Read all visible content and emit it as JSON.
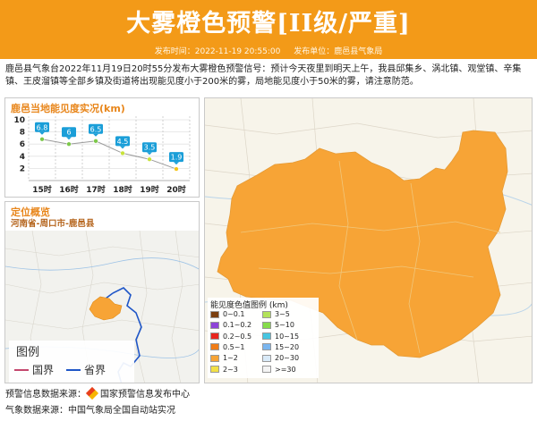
{
  "banner": {
    "title": "大雾橙色预警[II级/严重]",
    "publish_time_label": "发布时间：2022-11-19 20:55:00",
    "publisher_label": "发布单位：鹿邑县气象局",
    "color": "#f39a18"
  },
  "notice": {
    "text": "鹿邑县气象台2022年11月19日20时55分发布大雾橙色预警信号：预计今天夜里到明天上午，我县邱集乡、涡北镇、观堂镇、辛集镇、王皮溜镇等全部乡镇及街道将出现能见度小于200米的雾，局地能见度小于50米的雾，请注意防范。"
  },
  "visibility_panel": {
    "title": "鹿邑当地能见度实况(km)"
  },
  "chart_data": {
    "type": "line",
    "title": "鹿邑当地能见度实况(km)",
    "categories": [
      "15时",
      "16时",
      "17时",
      "18时",
      "19时",
      "20时"
    ],
    "values": [
      6.8,
      6,
      6.5,
      4.5,
      3.5,
      1.9
    ],
    "labels": [
      "6.8",
      "6",
      "6.5",
      "4.5",
      "3.5",
      "1.9"
    ],
    "yticks": [
      "10",
      "8",
      "6",
      "4",
      "2"
    ],
    "ylim": [
      0,
      10
    ],
    "grid": true,
    "line_color": "#9a9a9a",
    "marker_colors": [
      "#7dc84a",
      "#7dc84a",
      "#7dc84a",
      "#c8e23a",
      "#c8e23a",
      "#f5c51a"
    ],
    "label_box_color": "#1a9ed8"
  },
  "location_panel": {
    "title": "定位概览",
    "subtitle": "河南省-周口市-鹿邑县",
    "legend_title": "图例",
    "legend_items": [
      {
        "label": "国界",
        "color": "#c4476e"
      },
      {
        "label": "省界",
        "color": "#1f56c7"
      }
    ]
  },
  "map_legend": {
    "title": "能见度色值图例 (km)",
    "items": [
      {
        "label": "0~0.1",
        "color": "#7b3f10"
      },
      {
        "label": "3~5",
        "color": "#b3e35a"
      },
      {
        "label": "0.1~0.2",
        "color": "#8e44d8"
      },
      {
        "label": "5~10",
        "color": "#86dc4b"
      },
      {
        "label": "0.2~0.5",
        "color": "#e8261e"
      },
      {
        "label": "10~15",
        "color": "#47c5e0"
      },
      {
        "label": "0.5~1",
        "color": "#f07c17"
      },
      {
        "label": "15~20",
        "color": "#7ab6ef"
      },
      {
        "label": "1~2",
        "color": "#f7a436"
      },
      {
        "label": "20~30",
        "color": "#d9eaf8"
      },
      {
        "label": "2~3",
        "color": "#f2e046"
      },
      {
        "label": ">=30",
        "color": "#f4f4f4"
      }
    ]
  },
  "sources": {
    "warning_source": "预警信息数据来源：",
    "warning_source_name": "国家预警信息发布中心",
    "weather_source": "气象数据来源：中国气象局全国自动站实况"
  }
}
